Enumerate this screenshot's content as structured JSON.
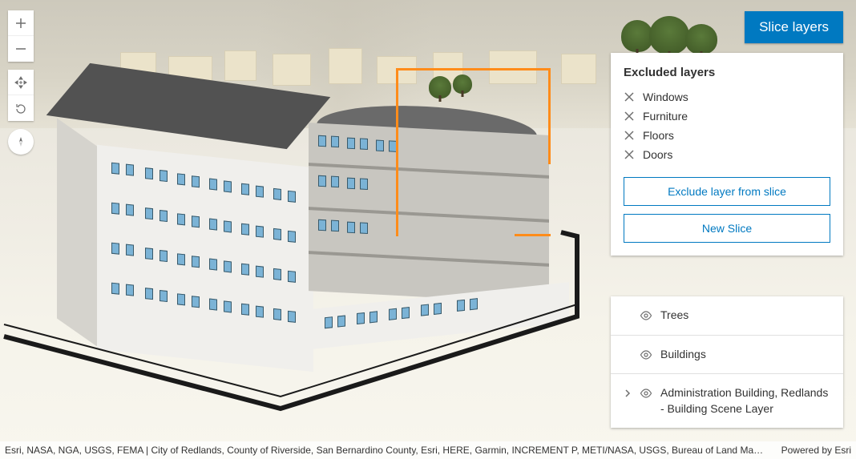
{
  "buttons": {
    "slice_layers": "Slice layers",
    "exclude_layer": "Exclude layer from slice",
    "new_slice": "New Slice"
  },
  "panel_slice": {
    "title": "Excluded layers",
    "layers": [
      "Windows",
      "Furniture",
      "Floors",
      "Doors"
    ]
  },
  "layer_list": {
    "items": [
      {
        "label": "Trees",
        "expandable": false
      },
      {
        "label": "Buildings",
        "expandable": false
      },
      {
        "label": "Administration Building, Redlands - Building Scene Layer",
        "expandable": true
      }
    ]
  },
  "attribution": {
    "left": "Esri, NASA, NGA, USGS, FEMA | City of Redlands, County of Riverside, San Bernardino County, Esri, HERE, Garmin, INCREMENT P, METI/NASA, USGS, Bureau of Land Manage…",
    "right": "Powered by Esri"
  }
}
